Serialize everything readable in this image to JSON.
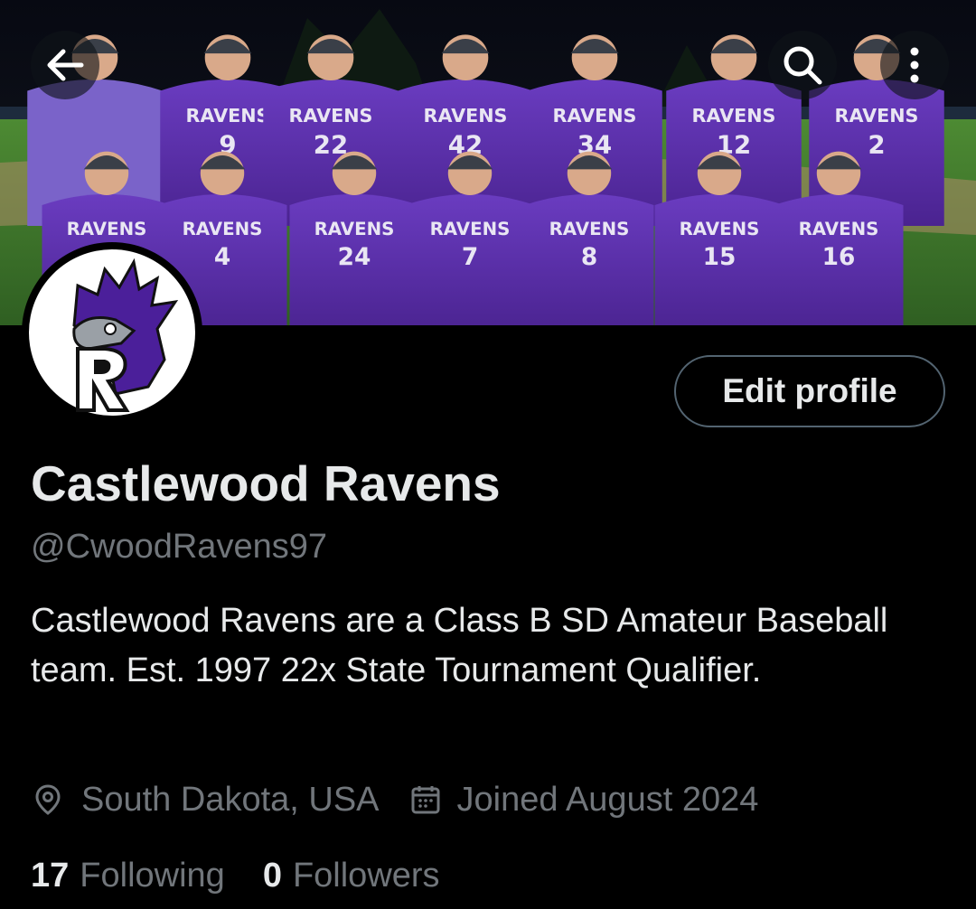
{
  "header": {
    "back_icon": "arrow-left-icon",
    "search_icon": "search-icon",
    "more_icon": "more-vertical-icon"
  },
  "banner": {
    "description_icon": "team-photo",
    "jersey_text": "RAVENS",
    "back_row_numbers": [
      "",
      "9",
      "22",
      "42",
      "34",
      "12",
      "2"
    ],
    "front_row_numbers": [
      "",
      "4",
      "24",
      "7",
      "8",
      "15",
      "16"
    ]
  },
  "profile": {
    "display_name": "Castlewood Ravens",
    "handle": "@CwoodRavens97",
    "bio": "Castlewood Ravens are a Class B SD Amateur Baseball team. Est. 1997 22x State Tournament Qualifier.",
    "location": "South Dakota, USA",
    "joined": "Joined August 2024",
    "location_icon": "location-pin-icon",
    "calendar_icon": "calendar-icon",
    "edit_label": "Edit profile"
  },
  "stats": {
    "following_count": "17",
    "following_label": "Following",
    "followers_count": "0",
    "followers_label": "Followers"
  },
  "colors": {
    "background": "#000000",
    "primary_text": "#e7e9ea",
    "secondary_text": "#71767b",
    "button_border": "#536471",
    "jersey_purple": "#5b2ea6",
    "field_green": "#3f7a2a"
  }
}
